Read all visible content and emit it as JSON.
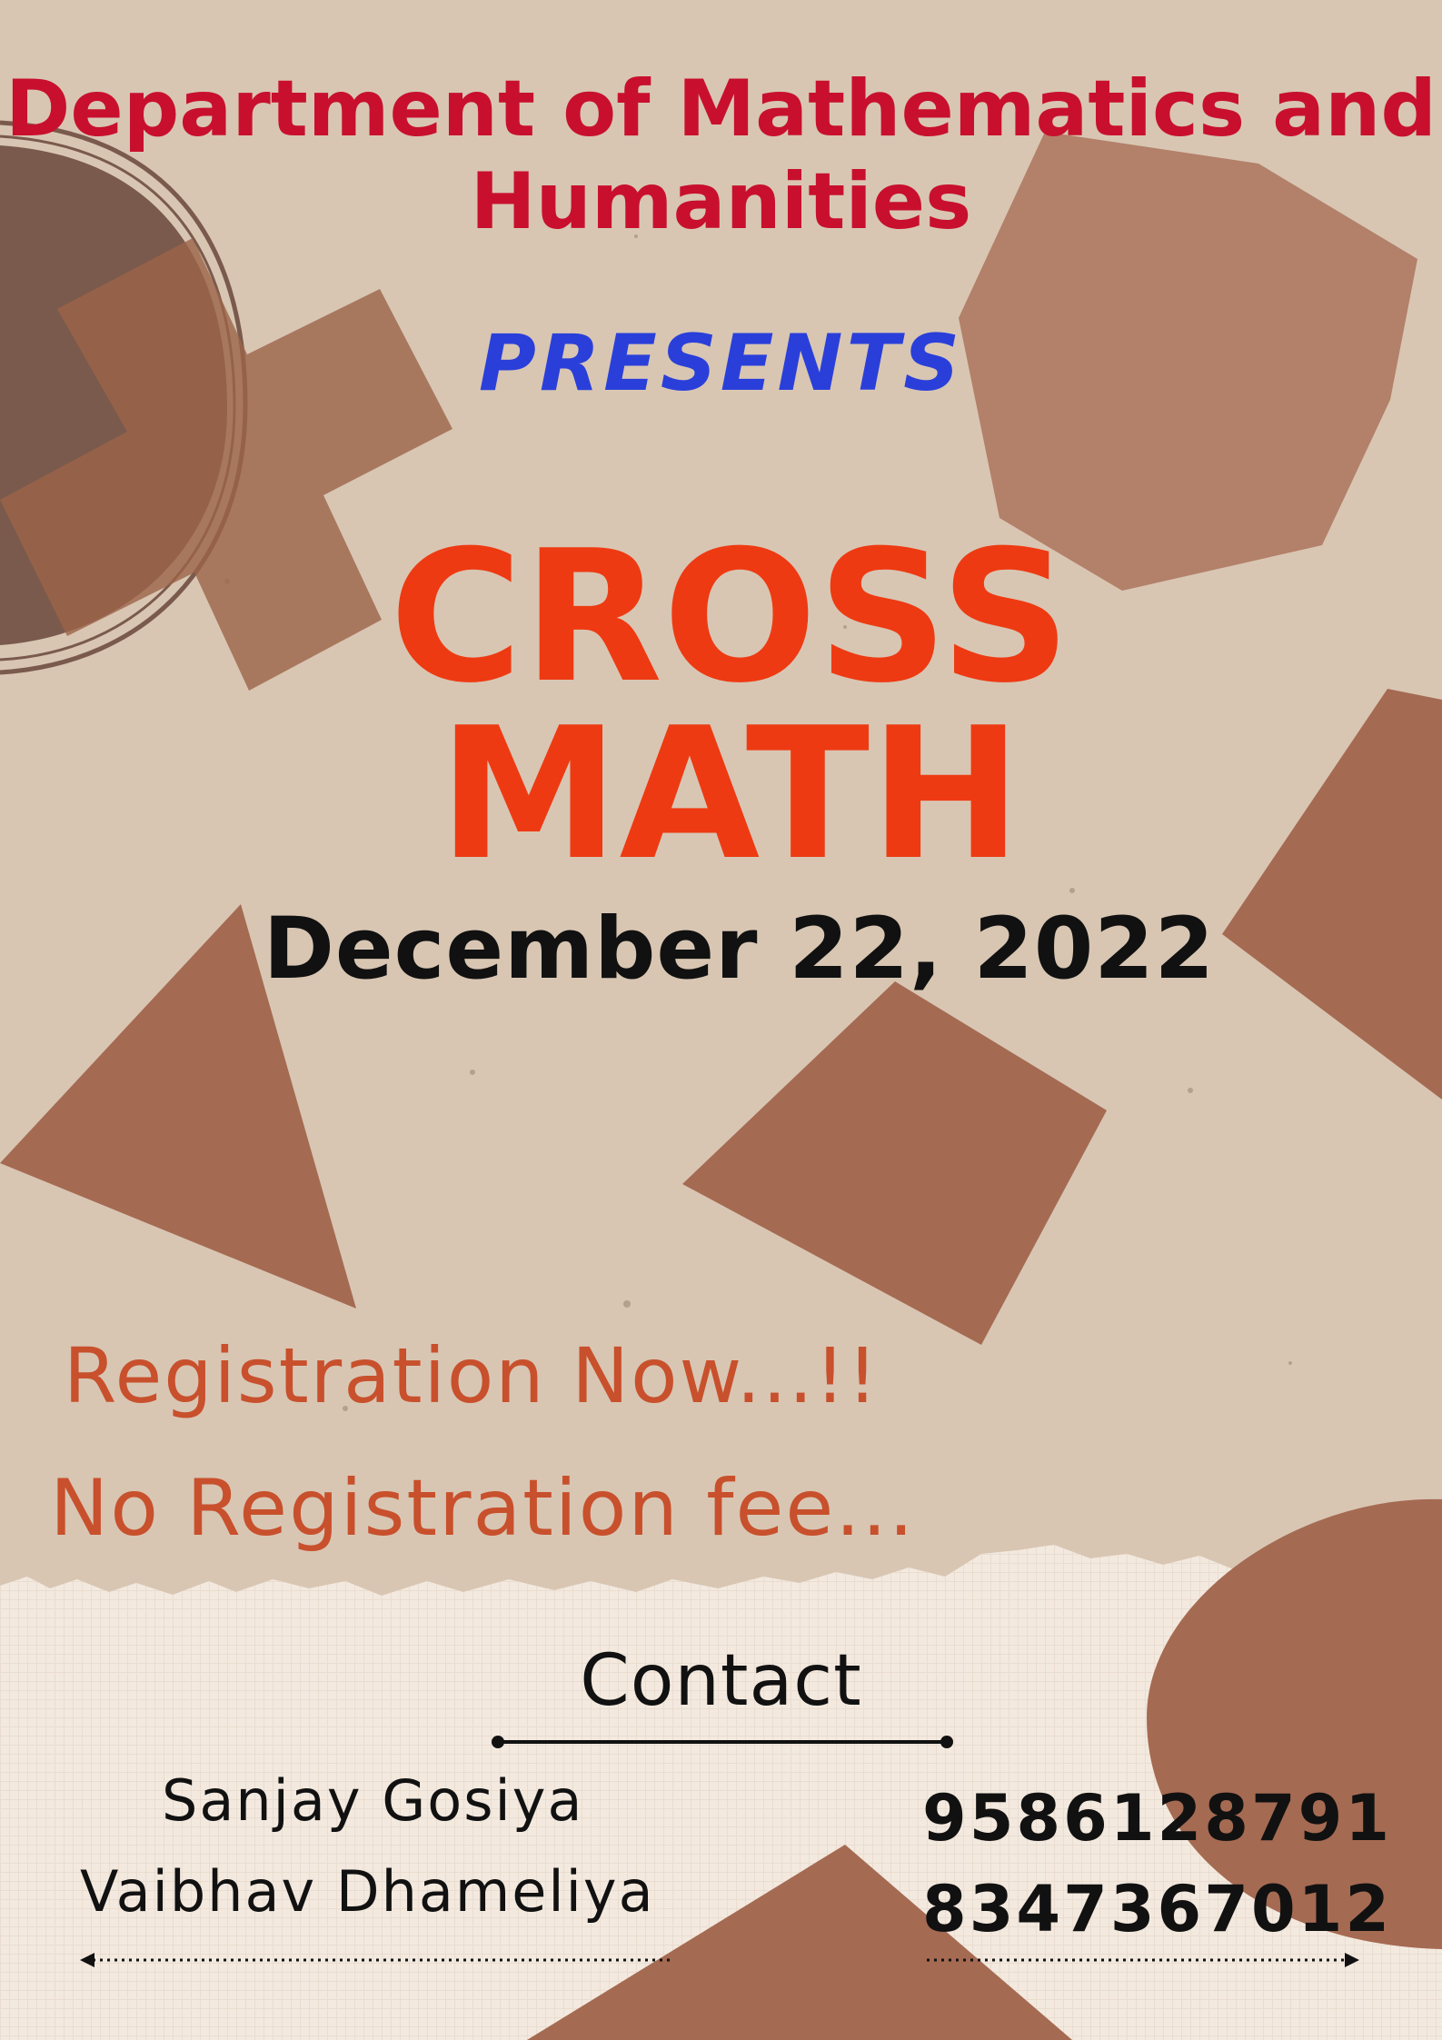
{
  "header": {
    "department_line1": "Department of Mathematics and",
    "department_line2": "Humanities",
    "presents": "PRESENTS"
  },
  "event": {
    "title_line1": "CROSS",
    "title_line2": "MATH",
    "date": "December 22, 2022"
  },
  "registration": {
    "line1": "Registration Now...!!",
    "line2": "No Registration fee..."
  },
  "contact": {
    "heading": "Contact",
    "people": [
      {
        "name": "Sanjay Gosiya",
        "phone": "9586128791"
      },
      {
        "name": "Vaibhav Dhameliya",
        "phone": "8347367012"
      }
    ]
  },
  "colors": {
    "department": "#c8102e",
    "presents": "#2a3fd9",
    "title": "#ee3a12",
    "registration": "#c8502c",
    "dark_text": "#111111",
    "shape": "#a56a52",
    "background": "#d8c6b3",
    "lower_paper": "#f3e9df"
  },
  "icons": [
    "circle-shape",
    "cross-shape",
    "octagon-shape",
    "diamond-shape",
    "triangle-shape",
    "square-shape",
    "semicircle-shape"
  ]
}
